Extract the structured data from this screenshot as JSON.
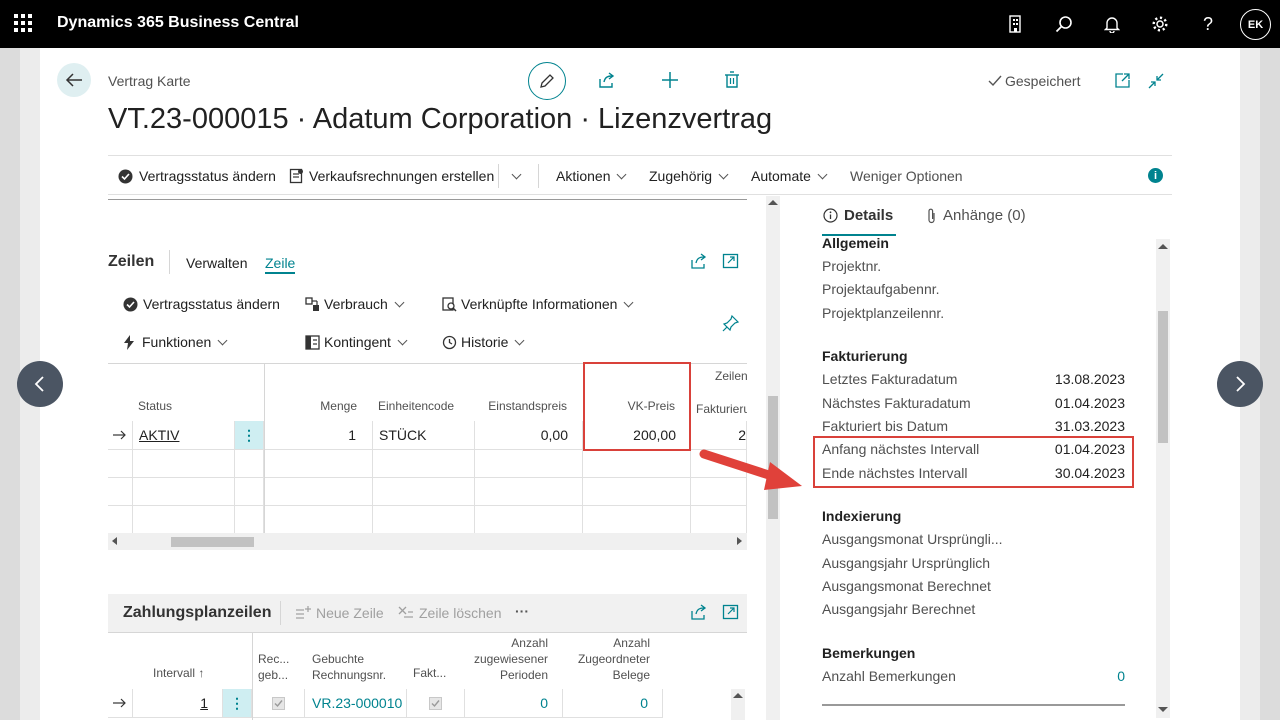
{
  "app": {
    "title": "Dynamics 365 Business Central",
    "avatar": "EK"
  },
  "page": {
    "breadcrumb": "Vertrag Karte",
    "title": "VT.23-000015 · Adatum Corporation · Lizenzvertrag",
    "saved": "Gespeichert"
  },
  "cmdbar": {
    "status": "Vertragsstatus ändern",
    "invoices": "Verkaufsrechnungen erstellen",
    "actions": "Aktionen",
    "related": "Zugehörig",
    "automate": "Automate",
    "fewer": "Weniger Optionen"
  },
  "lines": {
    "title": "Zeilen",
    "tab_manage": "Verwalten",
    "tab_line": "Zeile",
    "actions": {
      "status": "Vertragsstatus ändern",
      "usage": "Verbrauch",
      "linked": "Verknüpfte Informationen",
      "functions": "Funktionen",
      "quota": "Kontingent",
      "history": "Historie"
    },
    "headers": {
      "status": "Status",
      "qty": "Menge",
      "unit": "Einheitencode",
      "cost": "Einstandspreis",
      "price": "VK-Preis",
      "zeilen": "Zeilen",
      "faktur": "Fakturieru"
    },
    "row": {
      "status": "AKTIV",
      "qty": "1",
      "unit": "STÜCK",
      "cost": "0,00",
      "price": "200,00",
      "extra": "2"
    }
  },
  "payment": {
    "title": "Zahlungsplanzeilen",
    "new_line": "Neue Zeile",
    "delete_line": "Zeile löschen",
    "more": "···",
    "headers": {
      "interval": "Intervall ↑",
      "rec1": "Rec...",
      "rec2": "geb...",
      "booked1": "Gebuchte",
      "booked2": "Rechnungsnr.",
      "fakt": "Fakt...",
      "periods1": "Anzahl",
      "periods2": "zugewiesener",
      "periods3": "Perioden",
      "docs1": "Anzahl",
      "docs2": "Zugeordneter",
      "docs3": "Belege"
    },
    "row": {
      "interval": "1",
      "booked": "VR.23-000010",
      "periods": "0",
      "docs": "0"
    }
  },
  "factbox": {
    "tab_details": "Details",
    "tab_attachments": "Anhänge (0)",
    "general": {
      "title": "Allgemein",
      "items": [
        "Projektnr.",
        "Projektaufgabennr.",
        "Projektplanzeilennr."
      ]
    },
    "invoicing": {
      "title": "Fakturierung",
      "items": [
        {
          "label": "Letztes Fakturadatum",
          "value": "13.08.2023"
        },
        {
          "label": "Nächstes Fakturadatum",
          "value": "01.04.2023"
        },
        {
          "label": "Fakturiert bis Datum",
          "value": "31.03.2023"
        },
        {
          "label": "Anfang nächstes Intervall",
          "value": "01.04.2023"
        },
        {
          "label": "Ende nächstes Intervall",
          "value": "30.04.2023"
        }
      ]
    },
    "indexing": {
      "title": "Indexierung",
      "items": [
        "Ausgangsmonat Ursprüngli...",
        "Ausgangsjahr Ursprünglich",
        "Ausgangsmonat Berechnet",
        "Ausgangsjahr Berechnet"
      ]
    },
    "remarks": {
      "title": "Bemerkungen",
      "label": "Anzahl Bemerkungen",
      "value": "0"
    }
  },
  "colors": {
    "accent": "#00838f",
    "highlight": "#d9413a",
    "topbar": "#000000"
  }
}
